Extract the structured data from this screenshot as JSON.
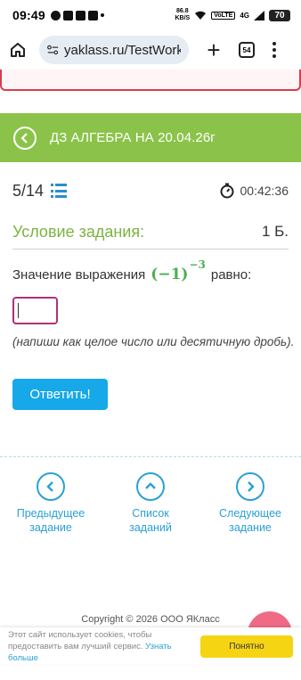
{
  "status_bar": {
    "time": "09:49",
    "net_rate_top": "86.8",
    "net_rate_bottom": "KB/S",
    "volte": "VoLTE",
    "signal_label": "4G",
    "battery": "70"
  },
  "browser": {
    "url": "yaklass.ru/TestWorkRun",
    "tabs_count": "54",
    "home_icon": "home-icon",
    "site_settings_icon": "site-settings-icon"
  },
  "header": {
    "title": "ДЗ АЛГЕБРА НА 20.04.26г",
    "color": "#8bc34a"
  },
  "progress": {
    "counter": "5/14",
    "timer": "00:42:36"
  },
  "task": {
    "condition_title": "Условие задания:",
    "points": "1 Б.",
    "question_prefix": "Значение выражения",
    "math_base": "(−1)",
    "math_exponent": "−3",
    "question_suffix": "равно:",
    "answer_value": "",
    "hint": "(напиши как целое число или десятичную дробь).",
    "submit_label": "Ответить!"
  },
  "nav": {
    "prev_line1": "Предыдущее",
    "prev_line2": "задание",
    "list_line1": "Список",
    "list_line2": "заданий",
    "next_line1": "Следующее",
    "next_line2": "задание"
  },
  "footer": {
    "copyright": "Copyright © 2026 ООО ЯКласс"
  },
  "cookie": {
    "text": "Этот сайт использует cookies, чтобы предоставить вам лучший сервис.",
    "link": "Узнать больше",
    "button": "Понятно"
  },
  "colors": {
    "accent_green": "#8bc34a",
    "accent_blue": "#16a8e8",
    "input_border": "#b0307a",
    "alert_red": "#d93c4b"
  }
}
